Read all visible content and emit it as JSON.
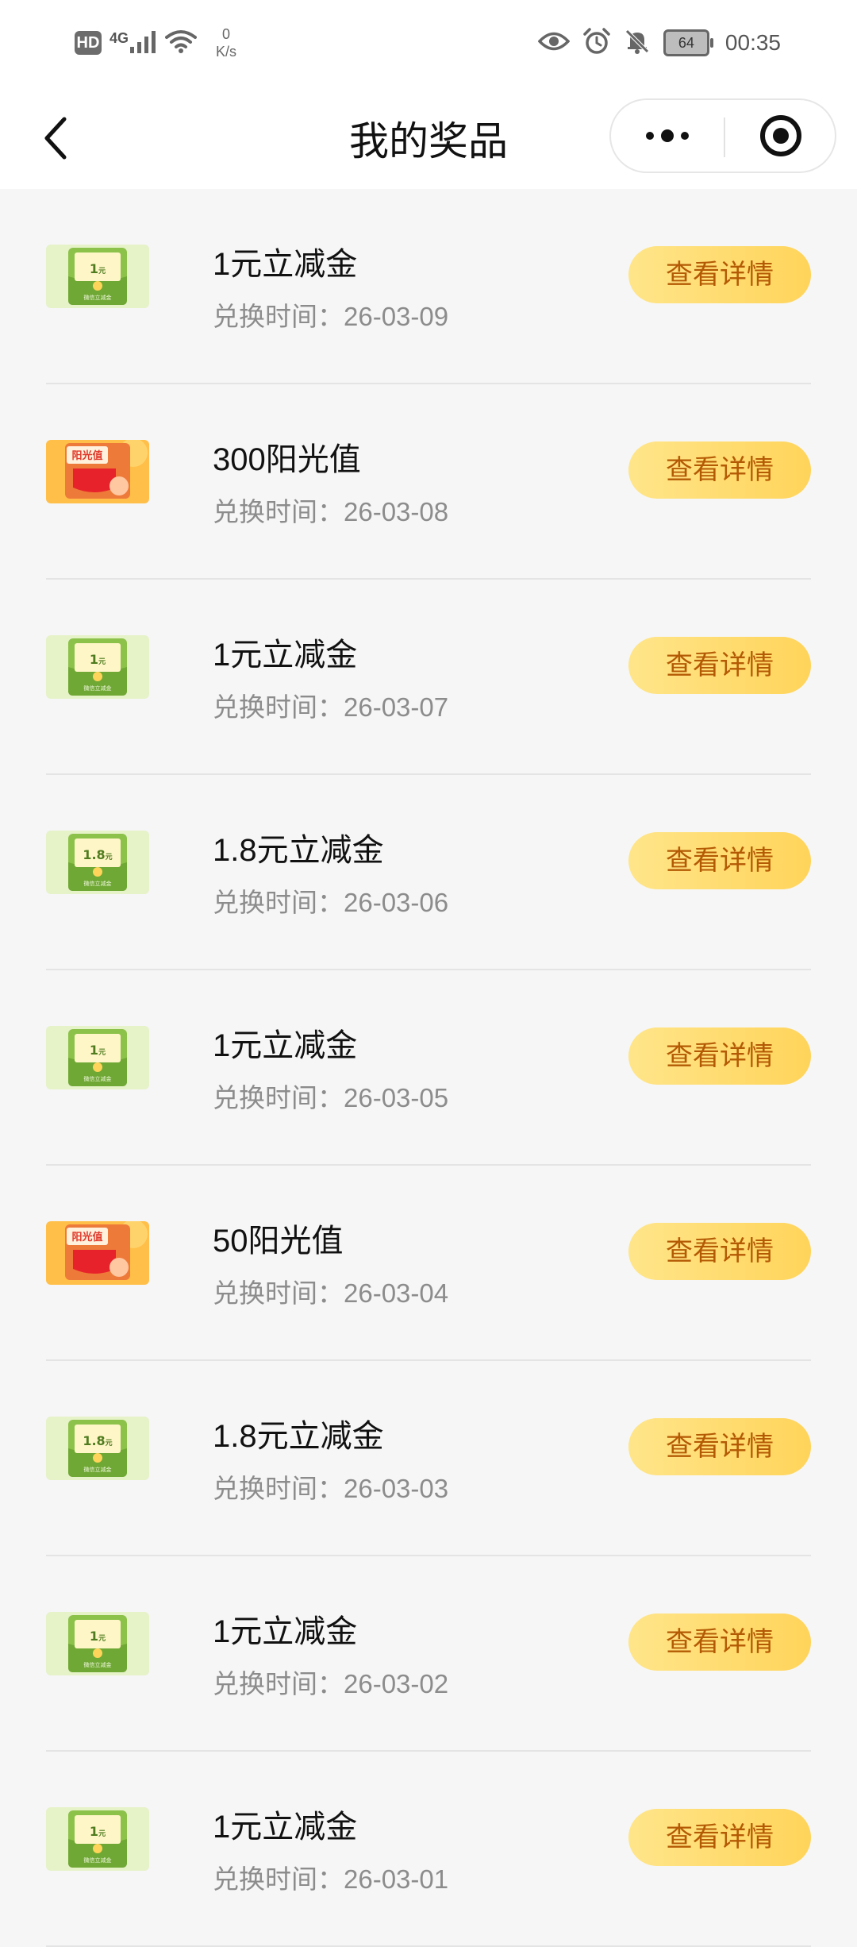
{
  "status_bar": {
    "hd_label": "HD",
    "network_label": "4G",
    "speed_value": "0",
    "speed_unit": "K/s",
    "battery_level": "64",
    "time": "00:35"
  },
  "header": {
    "title": "我的奖品"
  },
  "prizes": [
    {
      "name": "1元立减金",
      "date_label": "兑换时间：",
      "date": "26-03-09",
      "button": "查看详情",
      "type": "coupon",
      "amount": "1"
    },
    {
      "name": "300阳光值",
      "date_label": "兑换时间：",
      "date": "26-03-08",
      "button": "查看详情",
      "type": "sunshine",
      "amount": "阳光值"
    },
    {
      "name": "1元立减金",
      "date_label": "兑换时间：",
      "date": "26-03-07",
      "button": "查看详情",
      "type": "coupon",
      "amount": "1"
    },
    {
      "name": "1.8元立减金",
      "date_label": "兑换时间：",
      "date": "26-03-06",
      "button": "查看详情",
      "type": "coupon",
      "amount": "1.8"
    },
    {
      "name": "1元立减金",
      "date_label": "兑换时间：",
      "date": "26-03-05",
      "button": "查看详情",
      "type": "coupon",
      "amount": "1"
    },
    {
      "name": "50阳光值",
      "date_label": "兑换时间：",
      "date": "26-03-04",
      "button": "查看详情",
      "type": "sunshine",
      "amount": "阳光值"
    },
    {
      "name": "1.8元立减金",
      "date_label": "兑换时间：",
      "date": "26-03-03",
      "button": "查看详情",
      "type": "coupon",
      "amount": "1.8"
    },
    {
      "name": "1元立减金",
      "date_label": "兑换时间：",
      "date": "26-03-02",
      "button": "查看详情",
      "type": "coupon",
      "amount": "1"
    },
    {
      "name": "1元立减金",
      "date_label": "兑换时间：",
      "date": "26-03-01",
      "button": "查看详情",
      "type": "coupon",
      "amount": "1"
    }
  ],
  "thumb_text": {
    "coupon_unit": "元",
    "coupon_caption": "微信立减金"
  },
  "colors": {
    "button_bg": "#ffd45a",
    "button_text": "#b45a05",
    "coupon_green": "#8cc24a",
    "sunshine_orange": "#ffb53a"
  }
}
